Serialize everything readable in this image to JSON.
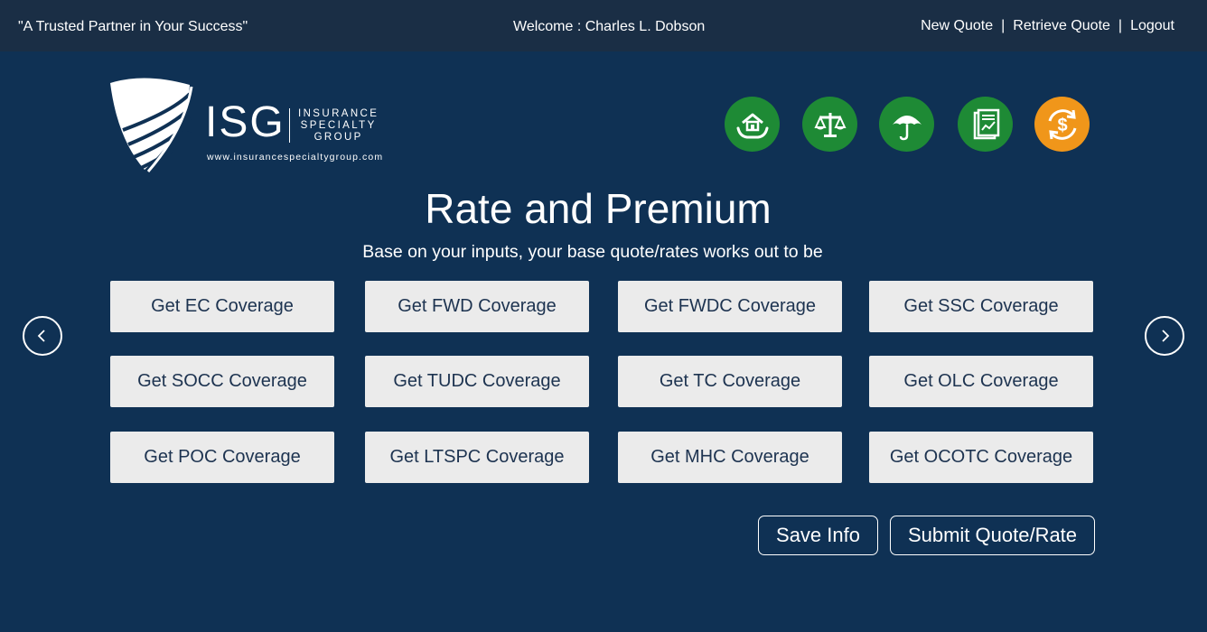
{
  "header": {
    "tagline": "\"A Trusted Partner in Your Success\"",
    "welcome": "Welcome : Charles L. Dobson",
    "nav": {
      "new_quote": "New Quote",
      "separator": "|",
      "retrieve_quote": "Retrieve Quote",
      "logout": "Logout"
    }
  },
  "logo": {
    "name": "ISG",
    "line1": "INSURANCE",
    "line2": "SPECIALTY",
    "line3": "GROUP",
    "url": "www.insurancespecialtygroup.com"
  },
  "icons": [
    {
      "name": "home-protection-icon",
      "color": "#1e8a35"
    },
    {
      "name": "scales-icon",
      "color": "#1e8a35"
    },
    {
      "name": "umbrella-icon",
      "color": "#1e8a35"
    },
    {
      "name": "document-chart-icon",
      "color": "#1e8a35"
    },
    {
      "name": "dollar-refresh-icon",
      "color": "#f0961a"
    }
  ],
  "main": {
    "title": "Rate and Premium",
    "subtitle": "Base on your inputs, your base quote/rates works out to be",
    "coverage_buttons": [
      "Get EC Coverage",
      "Get FWD Coverage",
      "Get FWDC Coverage",
      "Get SSC Coverage",
      "Get SOCC Coverage",
      "Get TUDC Coverage",
      "Get TC Coverage",
      "Get OLC Coverage",
      "Get POC Coverage",
      "Get LTSPC Coverage",
      "Get MHC Coverage",
      "Get OCOTC Coverage"
    ]
  },
  "actions": {
    "save": "Save Info",
    "submit": "Submit Quote/Rate"
  },
  "colors": {
    "background": "#0f3154",
    "topbar": "#1a2e45",
    "button_bg": "#ebebeb",
    "button_text": "#1d3350"
  }
}
